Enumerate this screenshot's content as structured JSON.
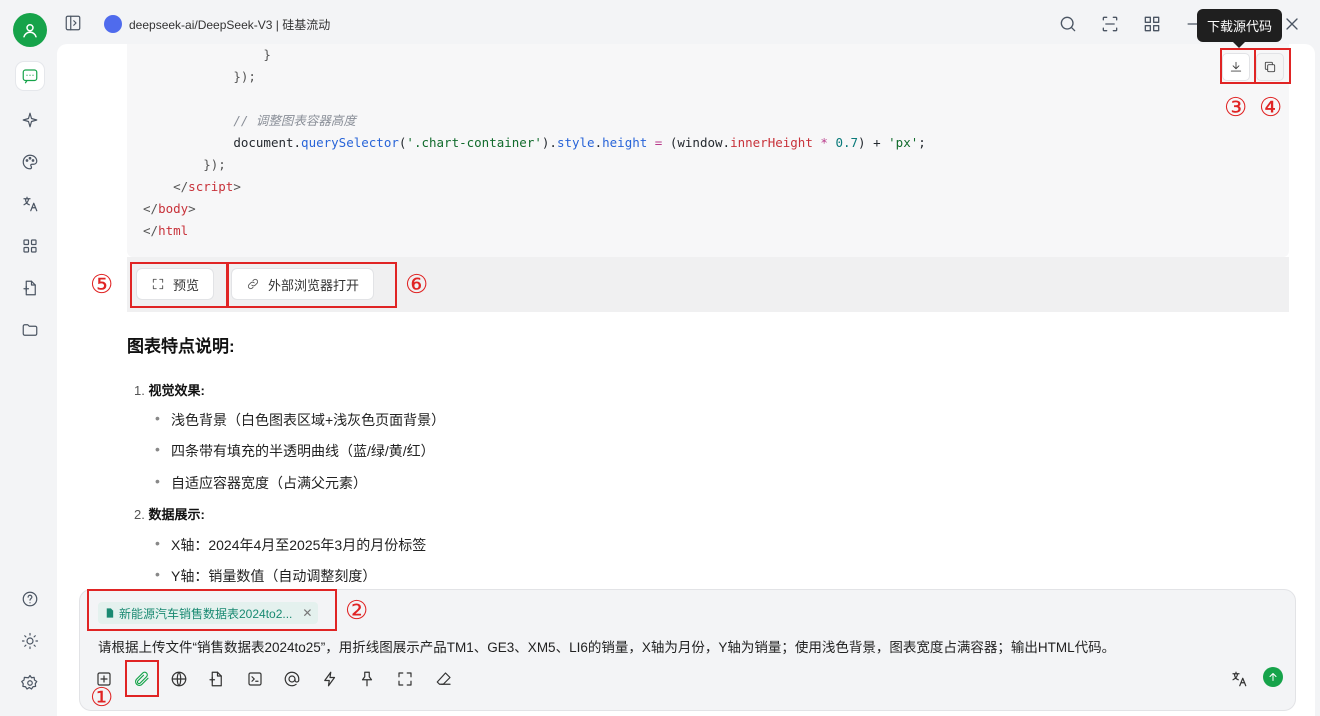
{
  "window": {
    "title": "deepseek-ai/DeepSeek-V3 | 硅基流动",
    "tooltip": "下载源代码"
  },
  "code_lines": [
    {
      "indent": "                ",
      "parts": [
        {
          "t": "}",
          "c": "pu"
        }
      ]
    },
    {
      "indent": "            ",
      "parts": [
        {
          "t": "});",
          "c": "pu"
        }
      ]
    },
    {
      "indent": "",
      "parts": []
    },
    {
      "indent": "            ",
      "parts": [
        {
          "t": "// 调整图表容器高度",
          "c": "cm"
        }
      ]
    },
    {
      "indent": "            ",
      "parts": [
        {
          "t": "document.",
          "c": ""
        },
        {
          "t": "querySelector",
          "c": "fn"
        },
        {
          "t": "(",
          "c": ""
        },
        {
          "t": "'.chart-container'",
          "c": "str"
        },
        {
          "t": ").",
          "c": ""
        },
        {
          "t": "style",
          "c": "fn"
        },
        {
          "t": ".",
          "c": ""
        },
        {
          "t": "height",
          "c": "fn"
        },
        {
          "t": " = ",
          "c": "op"
        },
        {
          "t": "(window.",
          "c": ""
        },
        {
          "t": "innerHeight",
          "c": "kw"
        },
        {
          "t": " * ",
          "c": "op"
        },
        {
          "t": "0.7",
          "c": "num"
        },
        {
          "t": ") + ",
          "c": ""
        },
        {
          "t": "'px'",
          "c": "str"
        },
        {
          "t": ";",
          "c": ""
        }
      ]
    },
    {
      "indent": "        ",
      "parts": [
        {
          "t": "});",
          "c": "pu"
        }
      ]
    },
    {
      "indent": "    ",
      "parts": [
        {
          "t": "</",
          "c": "pu"
        },
        {
          "t": "script",
          "c": "kw"
        },
        {
          "t": ">",
          "c": "pu"
        }
      ]
    },
    {
      "indent": "",
      "parts": [
        {
          "t": "</",
          "c": "pu"
        },
        {
          "t": "body",
          "c": "kw"
        },
        {
          "t": ">",
          "c": "pu"
        }
      ]
    },
    {
      "indent": "",
      "parts": [
        {
          "t": "</",
          "c": "pu"
        },
        {
          "t": "html",
          "c": "kw"
        }
      ]
    }
  ],
  "code_actions": {
    "preview_label": "预览",
    "open_external_label": "外部浏览器打开"
  },
  "annotations": {
    "m1": "①",
    "m2": "②",
    "m3": "③",
    "m4": "④",
    "m5": "⑤",
    "m6": "⑥"
  },
  "response": {
    "heading": "图表特点说明:",
    "sections": [
      {
        "num": "1.",
        "title": "视觉效果:",
        "bullets": [
          "浅色背景（白色图表区域+浅灰色页面背景）",
          "四条带有填充的半透明曲线（蓝/绿/黄/红）",
          "自适应容器宽度（占满父元素）"
        ]
      },
      {
        "num": "2.",
        "title": "数据展示:",
        "bullets": [
          "X轴：2024年4月至2025年3月的月份标签",
          "Y轴：销量数值（自动调整刻度）"
        ]
      }
    ]
  },
  "input": {
    "attachment_name": "新能源汽车销售数据表2024to2...",
    "prompt_text": "请根据上传文件“销售数据表2024to25”，用折线图展示产品TM1、GE3、XM5、LI6的销量，X轴为月份，Y轴为销量；使用浅色背景，图表宽度占满容器；输出HTML代码。"
  },
  "colors": {
    "accent": "#16a34a",
    "annotation_red": "#e02424"
  }
}
